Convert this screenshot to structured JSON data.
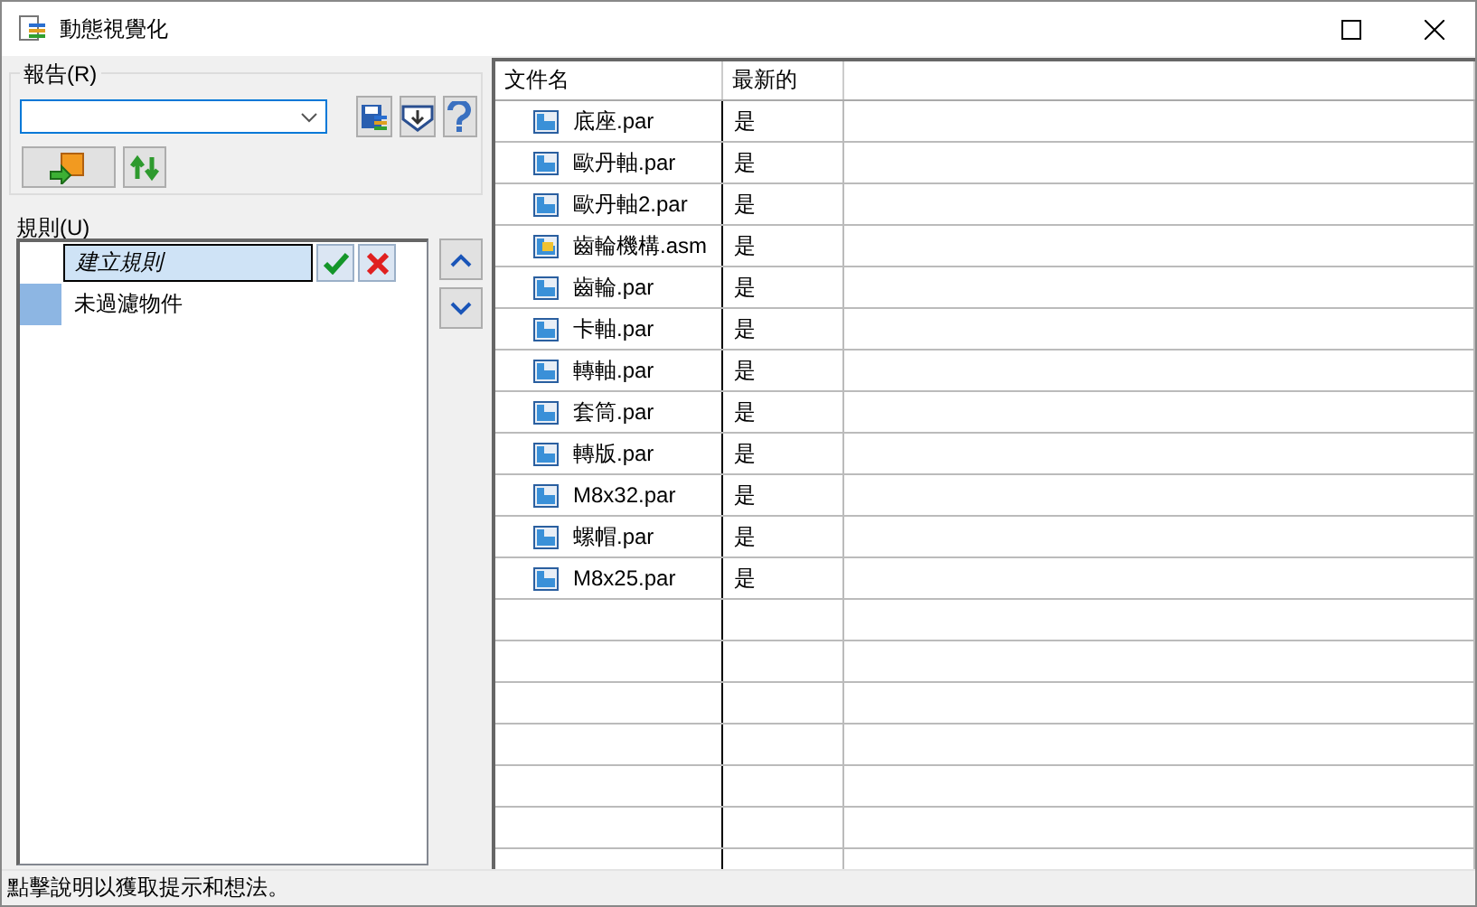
{
  "window": {
    "title": "動態視覺化"
  },
  "report": {
    "label": "報告(R)"
  },
  "rules": {
    "label": "規則(U)",
    "items": [
      {
        "kind": "input",
        "label": "建立規則",
        "selected": true
      },
      {
        "kind": "rule",
        "label": "未過濾物件",
        "color": "#8db6e3",
        "selected": false
      }
    ]
  },
  "table": {
    "columns": [
      "文件名",
      "最新的"
    ],
    "rows": [
      {
        "kind": "part",
        "name": "底座.par",
        "latest": "是"
      },
      {
        "kind": "part",
        "name": "歐丹軸.par",
        "latest": "是"
      },
      {
        "kind": "part",
        "name": "歐丹軸2.par",
        "latest": "是"
      },
      {
        "kind": "assembly",
        "name": "齒輪機構.asm",
        "latest": "是"
      },
      {
        "kind": "part",
        "name": "齒輪.par",
        "latest": "是"
      },
      {
        "kind": "part",
        "name": "卡軸.par",
        "latest": "是"
      },
      {
        "kind": "part",
        "name": "轉軸.par",
        "latest": "是"
      },
      {
        "kind": "part",
        "name": "套筒.par",
        "latest": "是"
      },
      {
        "kind": "part",
        "name": "轉版.par",
        "latest": "是"
      },
      {
        "kind": "part",
        "name": "M8x32.par",
        "latest": "是"
      },
      {
        "kind": "part",
        "name": "螺帽.par",
        "latest": "是"
      },
      {
        "kind": "part",
        "name": "M8x25.par",
        "latest": "是"
      }
    ]
  },
  "status_bar": "點擊說明以獲取提示和想法。"
}
